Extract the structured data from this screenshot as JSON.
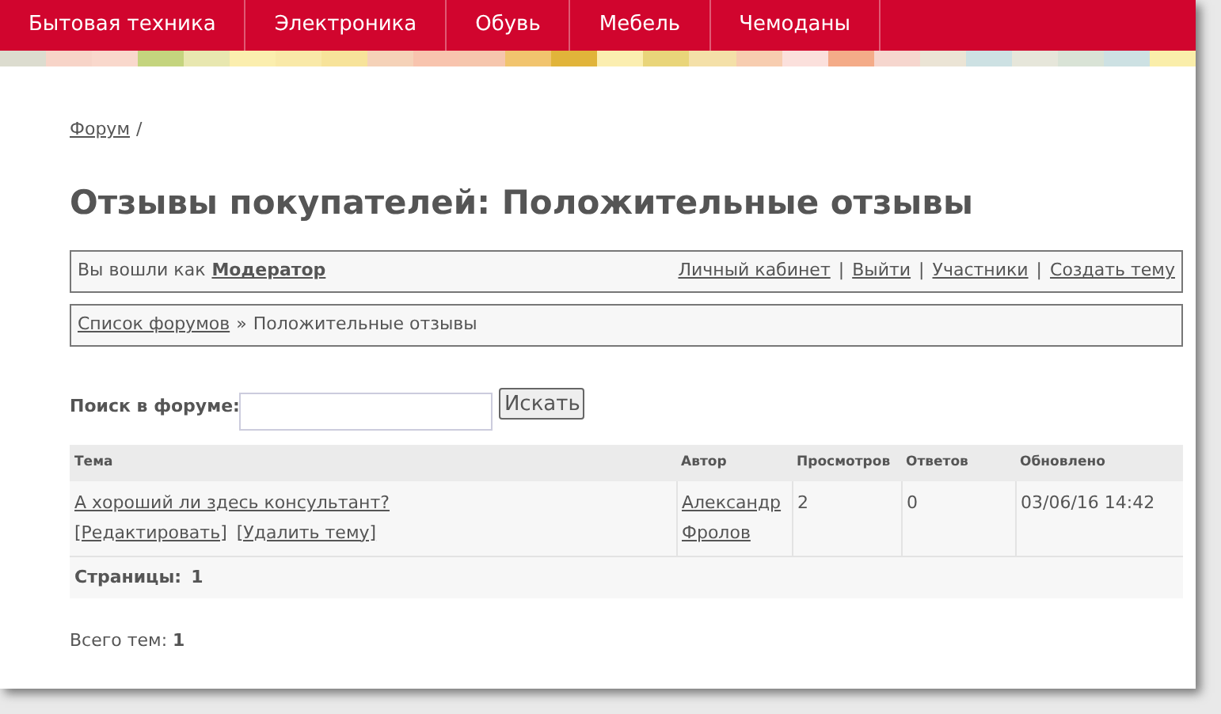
{
  "nav": {
    "items": [
      {
        "label": "Бытовая техника"
      },
      {
        "label": "Электроника"
      },
      {
        "label": "Обувь"
      },
      {
        "label": "Мебель"
      },
      {
        "label": "Чемоданы"
      }
    ]
  },
  "breadcrumb": {
    "link": "Форум",
    "separator": "/"
  },
  "title": "Отзывы покупателей: Положительные отзывы",
  "user_bar": {
    "text": "Вы вошли как",
    "user": "Модератор",
    "separator": "|",
    "links": [
      "Личный кабинет",
      "Выйти",
      "Участники",
      "Создать тему"
    ]
  },
  "forum_path": {
    "link": "Список форумов",
    "separator": "»",
    "current": "Положительные отзывы"
  },
  "search": {
    "label": "Поиск в форуме:",
    "button": "Искать"
  },
  "table": {
    "columns": [
      "Тема",
      "Автор",
      "Просмотров",
      "Ответов",
      "Обновлено"
    ],
    "rows": [
      {
        "topic": "А хороший ли здесь консультант?",
        "actions": [
          "[Редактировать]",
          "[Удалить тему]"
        ],
        "author": [
          "Александр",
          "Фролов"
        ],
        "views": "2",
        "replies": "0",
        "updated": "03/06/16 14:42"
      }
    ],
    "pages_label": "Страницы:",
    "pages_value": "1"
  },
  "total": "Всего тем: **1**"
}
